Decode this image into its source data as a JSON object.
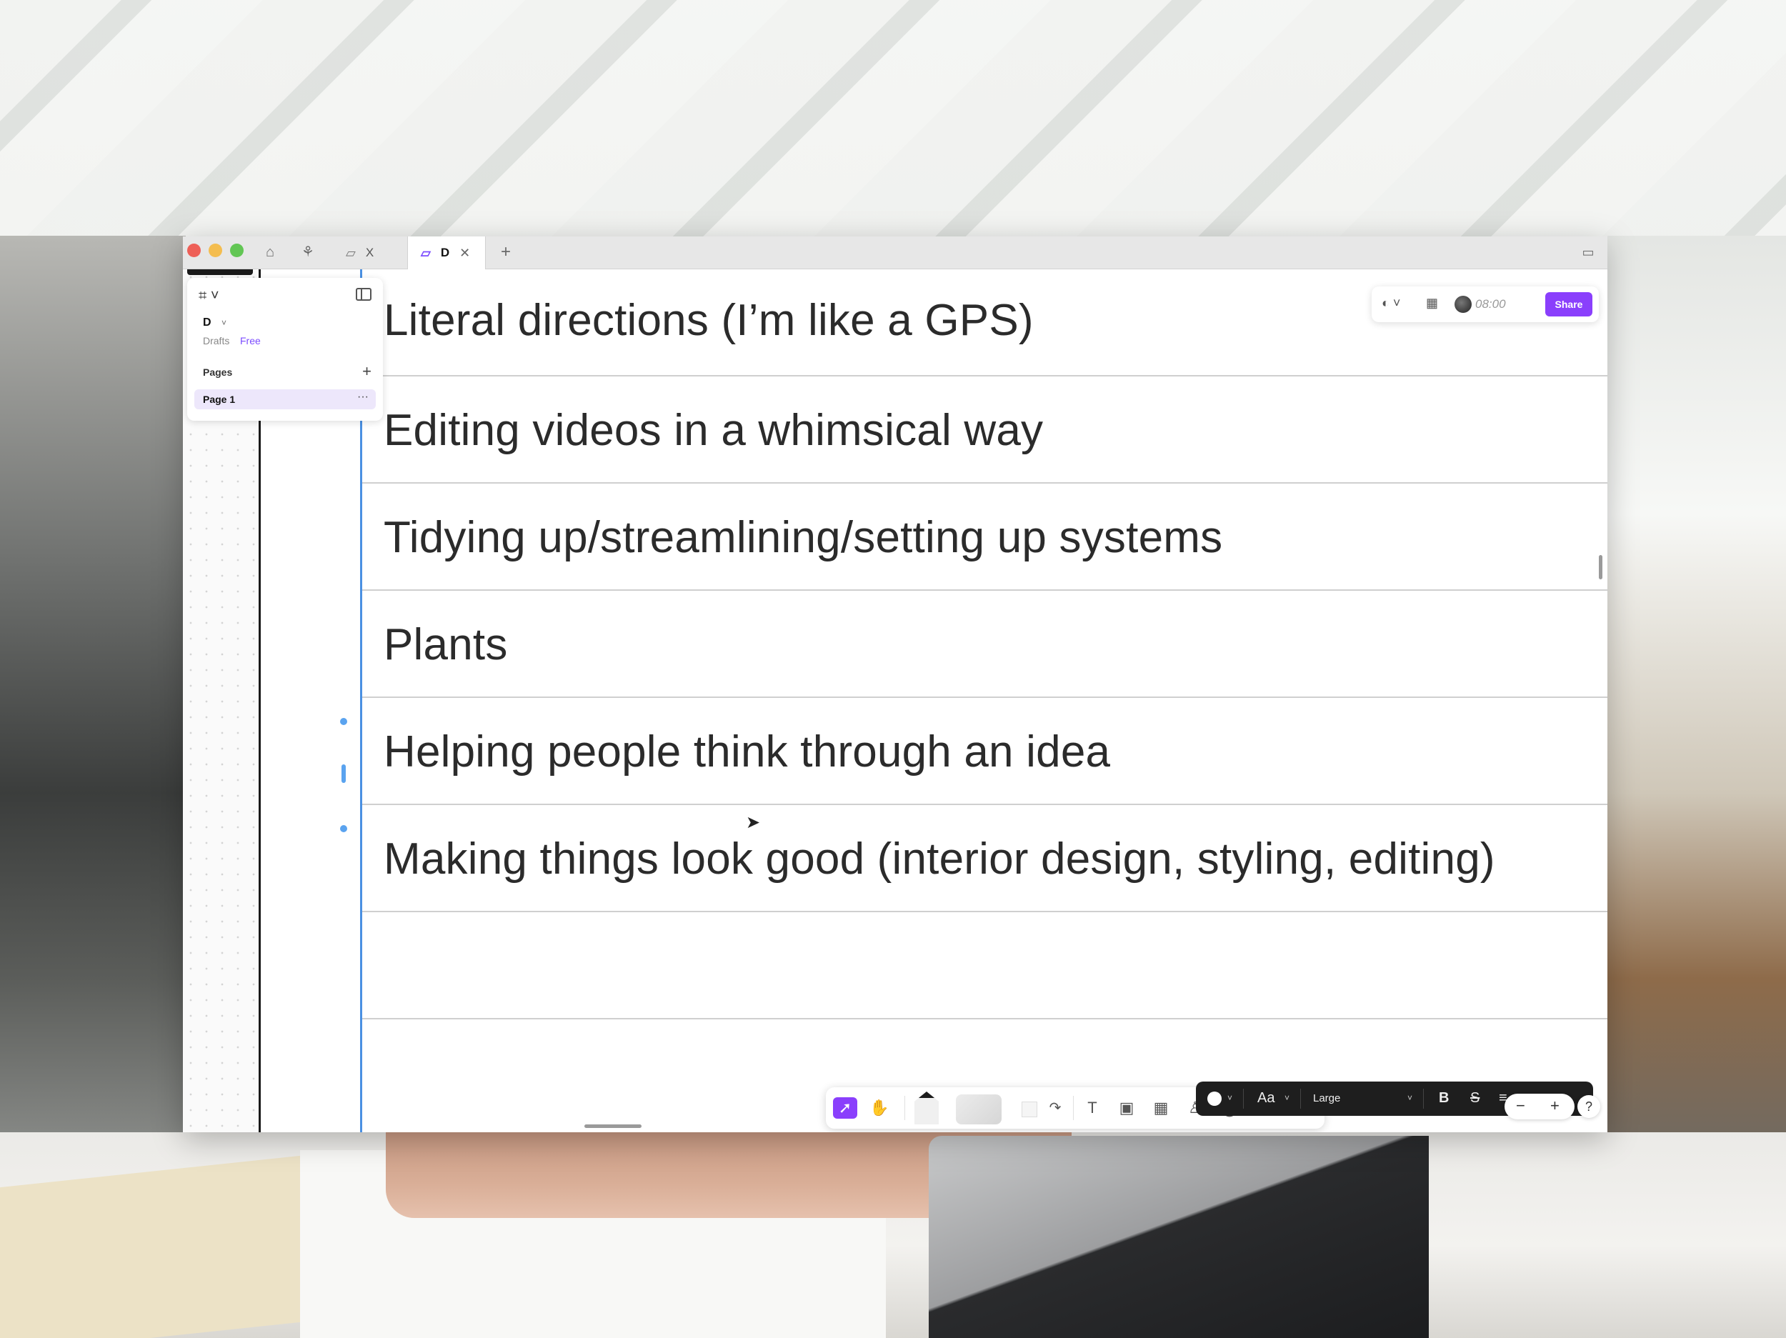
{
  "titlebar": {
    "tabs": [
      {
        "label": "X",
        "active": false
      },
      {
        "label": "D",
        "active": true
      }
    ],
    "home_icon": "home-icon",
    "community_icon": "community-icon",
    "new_tab_icon": "plus-icon",
    "window_icon": "window-layout-icon"
  },
  "sidebar": {
    "file_name": "D",
    "location": "Drafts",
    "plan_badge": "Free",
    "pages_label": "Pages",
    "pages": [
      {
        "label": "Page 1",
        "selected": true
      }
    ]
  },
  "canvas": {
    "rows": [
      {
        "text": "Literal directions (I’m like a GPS)"
      },
      {
        "text": "Editing videos in a whimsical way"
      },
      {
        "text": "Tidying up/streamlining/setting up systems"
      },
      {
        "text": "Plants"
      },
      {
        "text": "Helping people think through an idea"
      },
      {
        "text": "Making things look good (interior design, styling, editing)"
      },
      {
        "text": ""
      }
    ]
  },
  "top_right": {
    "timer": "08:00",
    "share_label": "Share"
  },
  "dock": {
    "tools": [
      "move-tool",
      "hand-tool",
      "pen-tool",
      "marker-tool",
      "shape-tool",
      "connector-tool",
      "text-tool",
      "section-tool",
      "table-tool",
      "stamp-tool",
      "comment-tool",
      "more-tools",
      "add-tool"
    ]
  },
  "format_bar": {
    "font_label": "Aa",
    "size_label": "Large",
    "bold_label": "B",
    "strike_label": "S"
  },
  "zoom": {
    "minus": "−",
    "plus": "+"
  },
  "help": {
    "label": "?"
  },
  "colors": {
    "accent": "#8a3ffc",
    "selection_blue": "#4a90e2",
    "page_selected_bg": "#ede7fb"
  }
}
